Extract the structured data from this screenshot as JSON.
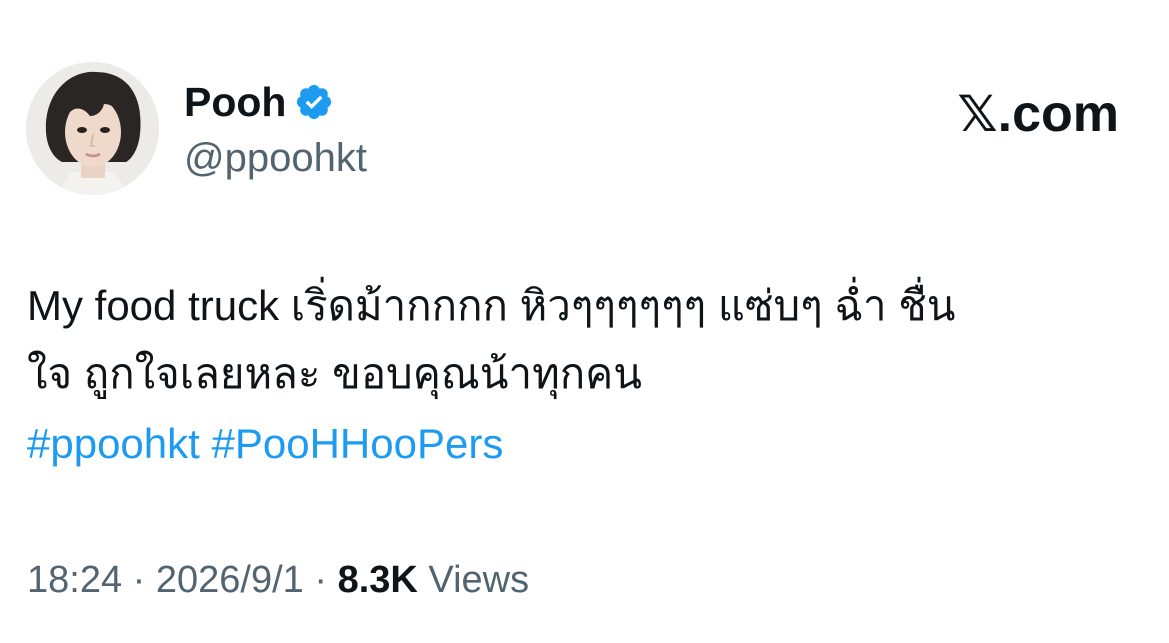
{
  "author": {
    "display_name": "Pooh",
    "handle": "@ppoohkt",
    "verified": true
  },
  "brand": {
    "label": ".com",
    "x_glyph": "𝕏"
  },
  "tweet": {
    "line1": "My food truck เริ่ดม้ากกกก หิวๆๆๆๆๆๆ แซ่บๆ ฉ่ำ ชื่น",
    "line2": "ใจ ถูกใจเลยหละ ขอบคุณน้าทุกคน",
    "hashtags": [
      "#ppoohkt",
      "#PooHHooPers"
    ]
  },
  "meta": {
    "time": "18:24",
    "separator": "·",
    "date": "2026/9/1",
    "views_count": "8.3K",
    "views_label": "Views"
  },
  "colors": {
    "text": "#0f1419",
    "secondary": "#536471",
    "link": "#1d9bf0",
    "badge": "#1d9bf0"
  },
  "icons": {
    "verified": "verified-badge-icon",
    "avatar": "profile-photo"
  }
}
